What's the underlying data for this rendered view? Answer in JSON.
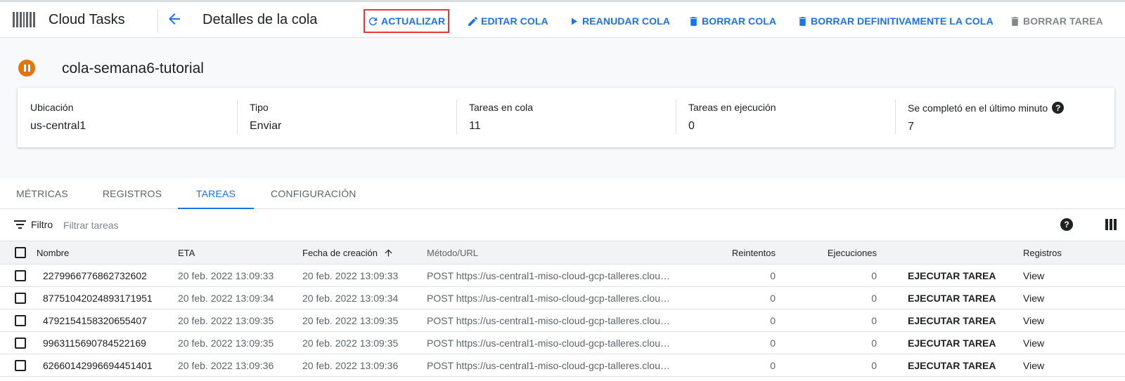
{
  "header": {
    "product": "Cloud Tasks",
    "page_title": "Detalles de la cola",
    "actions": [
      {
        "label": "ACTUALIZAR",
        "icon": "refresh-icon"
      },
      {
        "label": "EDITAR COLA",
        "icon": "pencil-icon"
      },
      {
        "label": "REANUDAR COLA",
        "icon": "play-icon"
      },
      {
        "label": "BORRAR COLA",
        "icon": "trash-icon"
      },
      {
        "label": "BORRAR DEFINITIVAMENTE LA COLA",
        "icon": "trash-icon"
      },
      {
        "label": "BORRAR TAREA",
        "icon": "trash-icon"
      }
    ],
    "highlight_color": "#e53935"
  },
  "queue": {
    "name": "cola-semana6-tutorial",
    "status": "paused",
    "status_color": "#e37400",
    "info": [
      {
        "label": "Ubicación",
        "value": "us-central1"
      },
      {
        "label": "Tipo",
        "value": "Enviar"
      },
      {
        "label": "Tareas en cola",
        "value": "11"
      },
      {
        "label": "Tareas en ejecución",
        "value": "0"
      },
      {
        "label": "Se completó en el último minuto",
        "value": "7"
      }
    ]
  },
  "tabs": [
    {
      "label": "MÉTRICAS"
    },
    {
      "label": "REGISTROS"
    },
    {
      "label": "TAREAS"
    },
    {
      "label": "CONFIGURACIÓN"
    }
  ],
  "active_tab": "TAREAS",
  "filter": {
    "label": "Filtro",
    "placeholder": "Filtrar tareas"
  },
  "table": {
    "columns": {
      "name": "Nombre",
      "eta": "ETA",
      "created": "Fecha de creación",
      "method": "Método/URL",
      "retries": "Reintentos",
      "executions": "Ejecuciones",
      "logs": "Registros"
    },
    "rows": [
      {
        "name": "2279966776862732602",
        "eta": "20 feb. 2022 13:09:33",
        "created": "20 feb. 2022 13:09:33",
        "method": "POST https://us-central1-miso-cloud-gcp-talleres.clou…",
        "retries": "0",
        "executions": "0",
        "action": "EJECUTAR TAREA",
        "logs": "View"
      },
      {
        "name": "87751042024893171951",
        "eta": "20 feb. 2022 13:09:34",
        "created": "20 feb. 2022 13:09:34",
        "method": "POST https://us-central1-miso-cloud-gcp-talleres.clou…",
        "retries": "0",
        "executions": "0",
        "action": "EJECUTAR TAREA",
        "logs": "View"
      },
      {
        "name": "4792154158320655407",
        "eta": "20 feb. 2022 13:09:35",
        "created": "20 feb. 2022 13:09:35",
        "method": "POST https://us-central1-miso-cloud-gcp-talleres.clou…",
        "retries": "0",
        "executions": "0",
        "action": "EJECUTAR TAREA",
        "logs": "View"
      },
      {
        "name": "9963115690784522169",
        "eta": "20 feb. 2022 13:09:35",
        "created": "20 feb. 2022 13:09:35",
        "method": "POST https://us-central1-miso-cloud-gcp-talleres.clou…",
        "retries": "0",
        "executions": "0",
        "action": "EJECUTAR TAREA",
        "logs": "View"
      },
      {
        "name": "62660142996694451401",
        "eta": "20 feb. 2022 13:09:36",
        "created": "20 feb. 2022 13:09:36",
        "method": "POST https://us-central1-miso-cloud-gcp-talleres.clou…",
        "retries": "0",
        "executions": "0",
        "action": "EJECUTAR TAREA",
        "logs": "View"
      }
    ]
  }
}
